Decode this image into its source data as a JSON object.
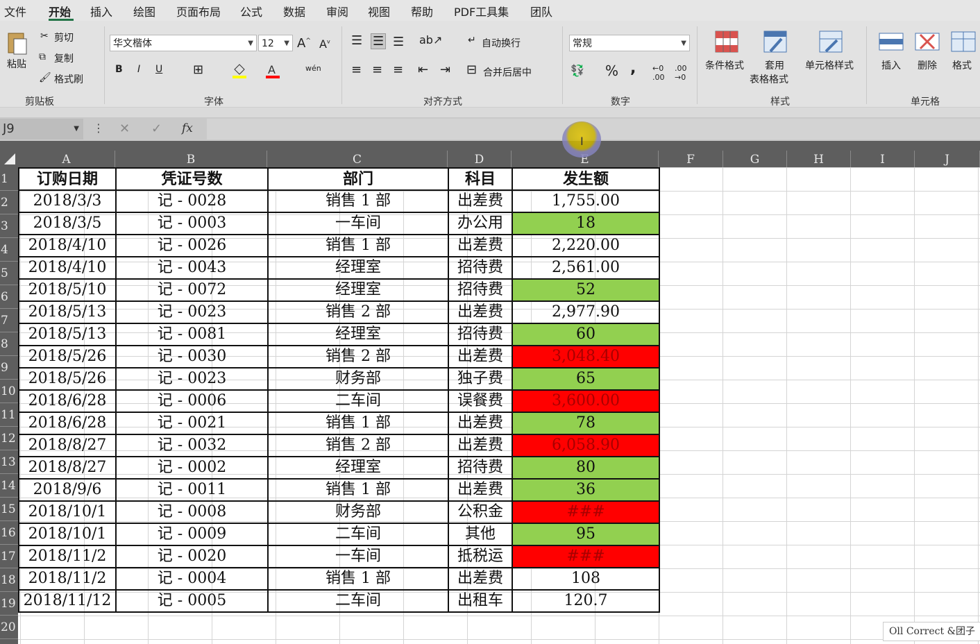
{
  "menu": [
    "文件",
    "开始",
    "插入",
    "绘图",
    "页面布局",
    "公式",
    "数据",
    "审阅",
    "视图",
    "帮助",
    "PDF工具集",
    "团队"
  ],
  "menu_active": "开始",
  "ribbon": {
    "clipboard": {
      "paste": "粘贴",
      "cut": "剪切",
      "copy": "复制",
      "format_painter": "格式刷",
      "label": "剪贴板"
    },
    "font": {
      "name": "华文楷体",
      "size": "12",
      "bold": "B",
      "italic": "I",
      "underline": "U",
      "label": "字体"
    },
    "alignment": {
      "wrap": "自动换行",
      "merge": "合并后居中",
      "label": "对齐方式"
    },
    "number": {
      "format": "常规",
      "percent": "%",
      "comma": ",",
      "label": "数字"
    },
    "styles": {
      "conditional": "条件格式",
      "table1": "套用",
      "table2": "表格格式",
      "cell_styles": "单元格样式",
      "label": "样式"
    },
    "cells": {
      "insert": "插入",
      "delete": "删除",
      "format": "格式",
      "label": "单元格"
    }
  },
  "formula_bar": {
    "name_box": "J9",
    "fx": "fx",
    "formula": ""
  },
  "columns": [
    "A",
    "B",
    "C",
    "D",
    "E",
    "F",
    "G",
    "H",
    "I",
    "J"
  ],
  "rows": [
    "1",
    "2",
    "3",
    "4",
    "5",
    "6",
    "7",
    "8",
    "9",
    "10",
    "11",
    "12",
    "13",
    "14",
    "15",
    "16",
    "17",
    "18",
    "19",
    "20"
  ],
  "table": {
    "headers": [
      "订购日期",
      "凭证号数",
      "部门",
      "科目",
      "发生额"
    ],
    "rows": [
      [
        "2018/3/3",
        "记 - 0028",
        "销售 1 部",
        "出差费",
        "1,755.00",
        ""
      ],
      [
        "2018/3/5",
        "记 - 0003",
        "一车间",
        "办公用",
        "18",
        "green"
      ],
      [
        "2018/4/10",
        "记 - 0026",
        "销售 1 部",
        "出差费",
        "2,220.00",
        ""
      ],
      [
        "2018/4/10",
        "记 - 0043",
        "经理室",
        "招待费",
        "2,561.00",
        ""
      ],
      [
        "2018/5/10",
        "记 - 0072",
        "经理室",
        "招待费",
        "52",
        "green"
      ],
      [
        "2018/5/13",
        "记 - 0023",
        "销售 2 部",
        "出差费",
        "2,977.90",
        ""
      ],
      [
        "2018/5/13",
        "记 - 0081",
        "经理室",
        "招待费",
        "60",
        "green"
      ],
      [
        "2018/5/26",
        "记 - 0030",
        "销售 2 部",
        "出差费",
        "3,048.40",
        "red"
      ],
      [
        "2018/5/26",
        "记 - 0023",
        "财务部",
        "独子费",
        "65",
        "green"
      ],
      [
        "2018/6/28",
        "记 - 0006",
        "二车间",
        "误餐费",
        "3,600.00",
        "red"
      ],
      [
        "2018/6/28",
        "记 - 0021",
        "销售 1 部",
        "出差费",
        "78",
        "green"
      ],
      [
        "2018/8/27",
        "记 - 0032",
        "销售 2 部",
        "出差费",
        "6,058.90",
        "red"
      ],
      [
        "2018/8/27",
        "记 - 0002",
        "经理室",
        "招待费",
        "80",
        "green"
      ],
      [
        "2018/9/6",
        "记 - 0011",
        "销售 1 部",
        "出差费",
        "36",
        "green"
      ],
      [
        "2018/10/1",
        "记 - 0008",
        "财务部",
        "公积金",
        "###",
        "red"
      ],
      [
        "2018/10/1",
        "记 - 0009",
        "二车间",
        "其他",
        "95",
        "green"
      ],
      [
        "2018/11/2",
        "记 - 0020",
        "一车间",
        "抵税运",
        "###",
        "red"
      ],
      [
        "2018/11/2",
        "记 - 0004",
        "销售 1 部",
        "出差费",
        "108",
        ""
      ],
      [
        "2018/11/12",
        "记 - 0005",
        "二车间",
        "出租车",
        "120.7",
        ""
      ]
    ]
  },
  "watermark": "Oll Correct &团子",
  "colors": {
    "green": "#92d050",
    "red": "#ff0000",
    "accent": "#217346"
  }
}
